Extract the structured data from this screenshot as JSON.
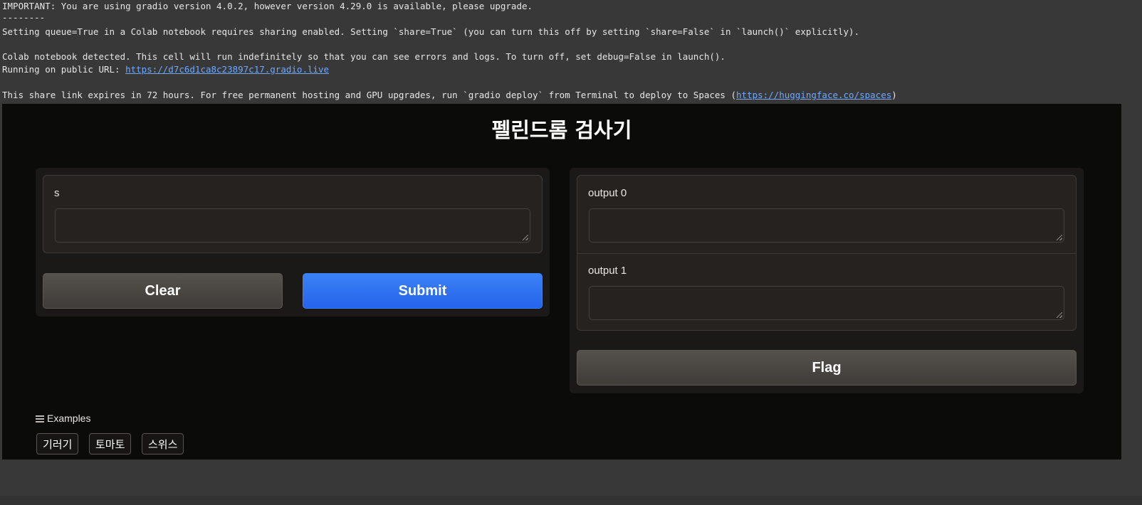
{
  "console": {
    "line1": "IMPORTANT: You are using gradio version 4.0.2, however version 4.29.0 is available, please upgrade.",
    "line2": "--------",
    "line3": "Setting queue=True in a Colab notebook requires sharing enabled. Setting `share=True` (you can turn this off by setting `share=False` in `launch()` explicitly).",
    "line4": "Colab notebook detected. This cell will run indefinitely so that you can see errors and logs. To turn off, set debug=False in launch().",
    "line5_prefix": "Running on public URL: ",
    "line5_link": "https://d7c6d1ca8c23897c17.gradio.live",
    "line6_prefix": "This share link expires in 72 hours. For free permanent hosting and GPU upgrades, run `gradio deploy` from Terminal to deploy to Spaces (",
    "line6_link": "https://huggingface.co/spaces",
    "line6_suffix": ")"
  },
  "app": {
    "title": "펠린드롬 검사기",
    "input": {
      "label": "s",
      "value": ""
    },
    "buttons": {
      "clear": "Clear",
      "submit": "Submit",
      "flag": "Flag"
    },
    "outputs": [
      {
        "label": "output 0",
        "value": ""
      },
      {
        "label": "output 1",
        "value": ""
      }
    ],
    "examples": {
      "heading": "Examples",
      "items": [
        "기러기",
        "토마토",
        "스위스"
      ]
    }
  },
  "colors": {
    "primary": "#2563eb",
    "app_background": "#0b0b0a",
    "console_background": "#383838",
    "link": "#6fa8ff"
  }
}
